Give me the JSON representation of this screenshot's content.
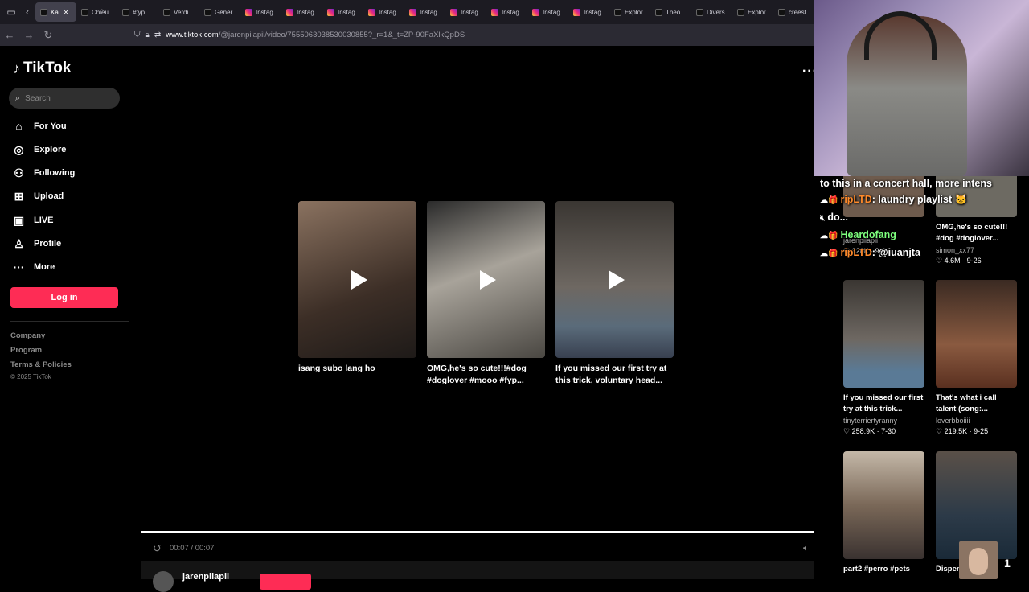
{
  "browser": {
    "tabs": [
      {
        "label": "Kal",
        "icon": "tiktok-favicon",
        "active": true
      },
      {
        "label": "Chiều",
        "icon": "tiktok-favicon"
      },
      {
        "label": "#fyp",
        "icon": "tiktok-favicon"
      },
      {
        "label": "Verdi",
        "icon": "tiktok-favicon"
      },
      {
        "label": "Gener",
        "icon": "tiktok-favicon"
      },
      {
        "label": "Instag",
        "icon": "instagram-favicon"
      },
      {
        "label": "Instag",
        "icon": "instagram-favicon"
      },
      {
        "label": "Instag",
        "icon": "instagram-favicon"
      },
      {
        "label": "Instag",
        "icon": "instagram-favicon"
      },
      {
        "label": "Instag",
        "icon": "instagram-favicon"
      },
      {
        "label": "Instag",
        "icon": "instagram-favicon"
      },
      {
        "label": "Instag",
        "icon": "instagram-favicon"
      },
      {
        "label": "Instag",
        "icon": "instagram-favicon"
      },
      {
        "label": "Instag",
        "icon": "instagram-favicon"
      },
      {
        "label": "Explor",
        "icon": "tiktok-favicon"
      },
      {
        "label": "Theo",
        "icon": "tiktok-favicon"
      },
      {
        "label": "Divers",
        "icon": "tiktok-favicon"
      },
      {
        "label": "Explor",
        "icon": "tiktok-favicon"
      },
      {
        "label": "creest",
        "icon": "tiktok-favicon"
      }
    ],
    "url_host": "www.tiktok.com",
    "url_path": "/@jarenpilapil/video/7555063038530030855?_r=1&_t=ZP-90FaXlkQpDS"
  },
  "sidebar": {
    "brand": "TikTok",
    "search_placeholder": "Search",
    "nav": [
      {
        "label": "For You",
        "icon": "home-icon"
      },
      {
        "label": "Explore",
        "icon": "compass-icon"
      },
      {
        "label": "Following",
        "icon": "following-icon"
      },
      {
        "label": "Upload",
        "icon": "upload-icon"
      },
      {
        "label": "LIVE",
        "icon": "live-icon"
      },
      {
        "label": "Profile",
        "icon": "profile-icon"
      },
      {
        "label": "More",
        "icon": "more-icon"
      }
    ],
    "login_label": "Log in",
    "footer": [
      "Company",
      "Program",
      "Terms & Policies"
    ],
    "copyright": "© 2025 TikTok"
  },
  "player": {
    "suggestions": [
      {
        "caption": "isang subo lang ho",
        "thumb_color": "#5a4638"
      },
      {
        "caption": "OMG,he's so cute!!!#dog #doglover #mooo #fyp...",
        "thumb_color": "#6d6a62"
      },
      {
        "caption": "If you missed our first try at this trick, voluntary head...",
        "thumb_color": "#5b5550"
      }
    ],
    "time": "00:07 / 00:07",
    "progress": 1.0,
    "author": "jarenpilapil"
  },
  "related": [
    {
      "caption": "",
      "user": "jarenpilapil",
      "likes": "320K",
      "date": "9-6",
      "thumb_color": "#6e5b4d"
    },
    {
      "caption": "OMG,he's so cute!!! #dog #doglover...",
      "user": "simon_xx77",
      "likes": "4.6M",
      "date": "9-26",
      "thumb_color": "#6d6a62"
    },
    {
      "caption": "If you missed our first try at this trick...",
      "user": "tinyterriertyranny",
      "likes": "258.9K",
      "date": "7-30",
      "thumb_color": "#5b5550"
    },
    {
      "caption": "That's what i call talent (song:...",
      "user": "loverbboiiii",
      "likes": "219.5K",
      "date": "9-25",
      "thumb_color": "#6e4a3a"
    },
    {
      "caption": "part2 #perro #pets",
      "user": "",
      "likes": "",
      "date": "",
      "thumb_color": "#7a6858"
    },
    {
      "caption": "Dispen",
      "user": "",
      "likes": "",
      "date": "",
      "thumb_color": "#2c3a48"
    }
  ],
  "stream": {
    "banner": "to this in a concert hall, more intens",
    "chat": [
      {
        "user": "ripLTD",
        "msg": ": laundry playlist 🐱"
      },
      {
        "user": "",
        "msg": "do..."
      },
      {
        "user": "Heardofang",
        "msg": ""
      },
      {
        "user": "ripLTD",
        "msg": ": @iuanjta"
      }
    ],
    "pip_count": "1"
  },
  "colors": {
    "accent": "#fe2c55",
    "background": "#000000"
  }
}
